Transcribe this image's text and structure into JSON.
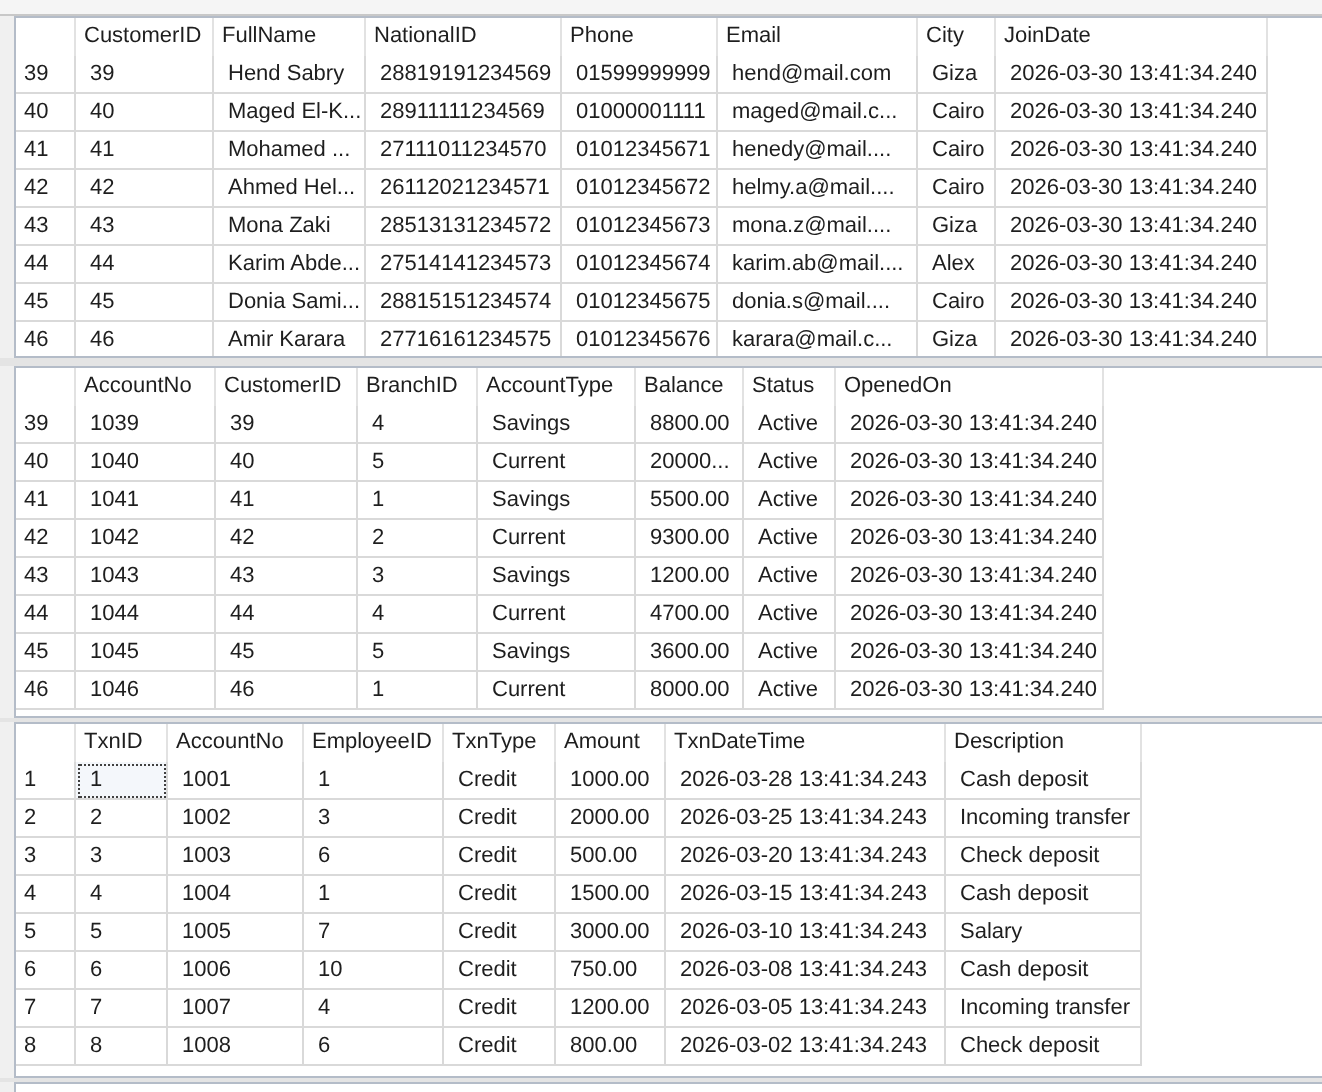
{
  "grids": [
    {
      "columns": [
        "CustomerID",
        "FullName",
        "NationalID",
        "Phone",
        "Email",
        "City",
        "JoinDate"
      ],
      "rows": [
        {
          "number": "39",
          "focused": false,
          "cells": [
            "39",
            "Hend Sabry",
            "28819191234569",
            "01599999999",
            "hend@mail.com",
            "Giza",
            "2026-03-30 13:41:34.240"
          ]
        },
        {
          "number": "40",
          "focused": false,
          "cells": [
            "40",
            "Maged El-K...",
            "28911111234569",
            "01000001111",
            "maged@mail.c...",
            "Cairo",
            "2026-03-30 13:41:34.240"
          ]
        },
        {
          "number": "41",
          "focused": false,
          "cells": [
            "41",
            "Mohamed ...",
            "27111011234570",
            "01012345671",
            "henedy@mail....",
            "Cairo",
            "2026-03-30 13:41:34.240"
          ]
        },
        {
          "number": "42",
          "focused": false,
          "cells": [
            "42",
            "Ahmed Hel...",
            "26112021234571",
            "01012345672",
            "helmy.a@mail....",
            "Cairo",
            "2026-03-30 13:41:34.240"
          ]
        },
        {
          "number": "43",
          "focused": false,
          "cells": [
            "43",
            "Mona Zaki",
            "28513131234572",
            "01012345673",
            "mona.z@mail....",
            "Giza",
            "2026-03-30 13:41:34.240"
          ]
        },
        {
          "number": "44",
          "focused": false,
          "cells": [
            "44",
            "Karim Abde...",
            "27514141234573",
            "01012345674",
            "karim.ab@mail....",
            "Alex",
            "2026-03-30 13:41:34.240"
          ]
        },
        {
          "number": "45",
          "focused": false,
          "cells": [
            "45",
            "Donia Sami...",
            "28815151234574",
            "01012345675",
            "donia.s@mail....",
            "Cairo",
            "2026-03-30 13:41:34.240"
          ]
        },
        {
          "number": "46",
          "focused": false,
          "cells": [
            "46",
            "Amir Karara",
            "27716161234575",
            "01012345676",
            "karara@mail.c...",
            "Giza",
            "2026-03-30 13:41:34.240"
          ]
        }
      ]
    },
    {
      "columns": [
        "AccountNo",
        "CustomerID",
        "BranchID",
        "AccountType",
        "Balance",
        "Status",
        "OpenedOn"
      ],
      "rows": [
        {
          "number": "39",
          "focused": false,
          "cells": [
            "1039",
            "39",
            "4",
            "Savings",
            "8800.00",
            "Active",
            "2026-03-30 13:41:34.240"
          ]
        },
        {
          "number": "40",
          "focused": false,
          "cells": [
            "1040",
            "40",
            "5",
            "Current",
            "20000...",
            "Active",
            "2026-03-30 13:41:34.240"
          ]
        },
        {
          "number": "41",
          "focused": false,
          "cells": [
            "1041",
            "41",
            "1",
            "Savings",
            "5500.00",
            "Active",
            "2026-03-30 13:41:34.240"
          ]
        },
        {
          "number": "42",
          "focused": false,
          "cells": [
            "1042",
            "42",
            "2",
            "Current",
            "9300.00",
            "Active",
            "2026-03-30 13:41:34.240"
          ]
        },
        {
          "number": "43",
          "focused": false,
          "cells": [
            "1043",
            "43",
            "3",
            "Savings",
            "1200.00",
            "Active",
            "2026-03-30 13:41:34.240"
          ]
        },
        {
          "number": "44",
          "focused": false,
          "cells": [
            "1044",
            "44",
            "4",
            "Current",
            "4700.00",
            "Active",
            "2026-03-30 13:41:34.240"
          ]
        },
        {
          "number": "45",
          "focused": false,
          "cells": [
            "1045",
            "45",
            "5",
            "Savings",
            "3600.00",
            "Active",
            "2026-03-30 13:41:34.240"
          ]
        },
        {
          "number": "46",
          "focused": false,
          "cells": [
            "1046",
            "46",
            "1",
            "Current",
            "8000.00",
            "Active",
            "2026-03-30 13:41:34.240"
          ]
        }
      ]
    },
    {
      "columns": [
        "TxnID",
        "AccountNo",
        "EmployeeID",
        "TxnType",
        "Amount",
        "TxnDateTime",
        "Description"
      ],
      "rows": [
        {
          "number": "1",
          "focused": true,
          "cells": [
            "1",
            "1001",
            "1",
            "Credit",
            "1000.00",
            "2026-03-28 13:41:34.243",
            "Cash deposit"
          ]
        },
        {
          "number": "2",
          "focused": false,
          "cells": [
            "2",
            "1002",
            "3",
            "Credit",
            "2000.00",
            "2026-03-25 13:41:34.243",
            "Incoming transfer"
          ]
        },
        {
          "number": "3",
          "focused": false,
          "cells": [
            "3",
            "1003",
            "6",
            "Credit",
            "500.00",
            "2026-03-20 13:41:34.243",
            "Check deposit"
          ]
        },
        {
          "number": "4",
          "focused": false,
          "cells": [
            "4",
            "1004",
            "1",
            "Credit",
            "1500.00",
            "2026-03-15 13:41:34.243",
            "Cash deposit"
          ]
        },
        {
          "number": "5",
          "focused": false,
          "cells": [
            "5",
            "1005",
            "7",
            "Credit",
            "3000.00",
            "2026-03-10 13:41:34.243",
            "Salary"
          ]
        },
        {
          "number": "6",
          "focused": false,
          "cells": [
            "6",
            "1006",
            "10",
            "Credit",
            "750.00",
            "2026-03-08 13:41:34.243",
            "Cash deposit"
          ]
        },
        {
          "number": "7",
          "focused": false,
          "cells": [
            "7",
            "1007",
            "4",
            "Credit",
            "1200.00",
            "2026-03-05 13:41:34.243",
            "Incoming transfer"
          ]
        },
        {
          "number": "8",
          "focused": false,
          "cells": [
            "8",
            "1008",
            "6",
            "Credit",
            "800.00",
            "2026-03-02 13:41:34.243",
            "Check deposit"
          ]
        }
      ]
    }
  ]
}
